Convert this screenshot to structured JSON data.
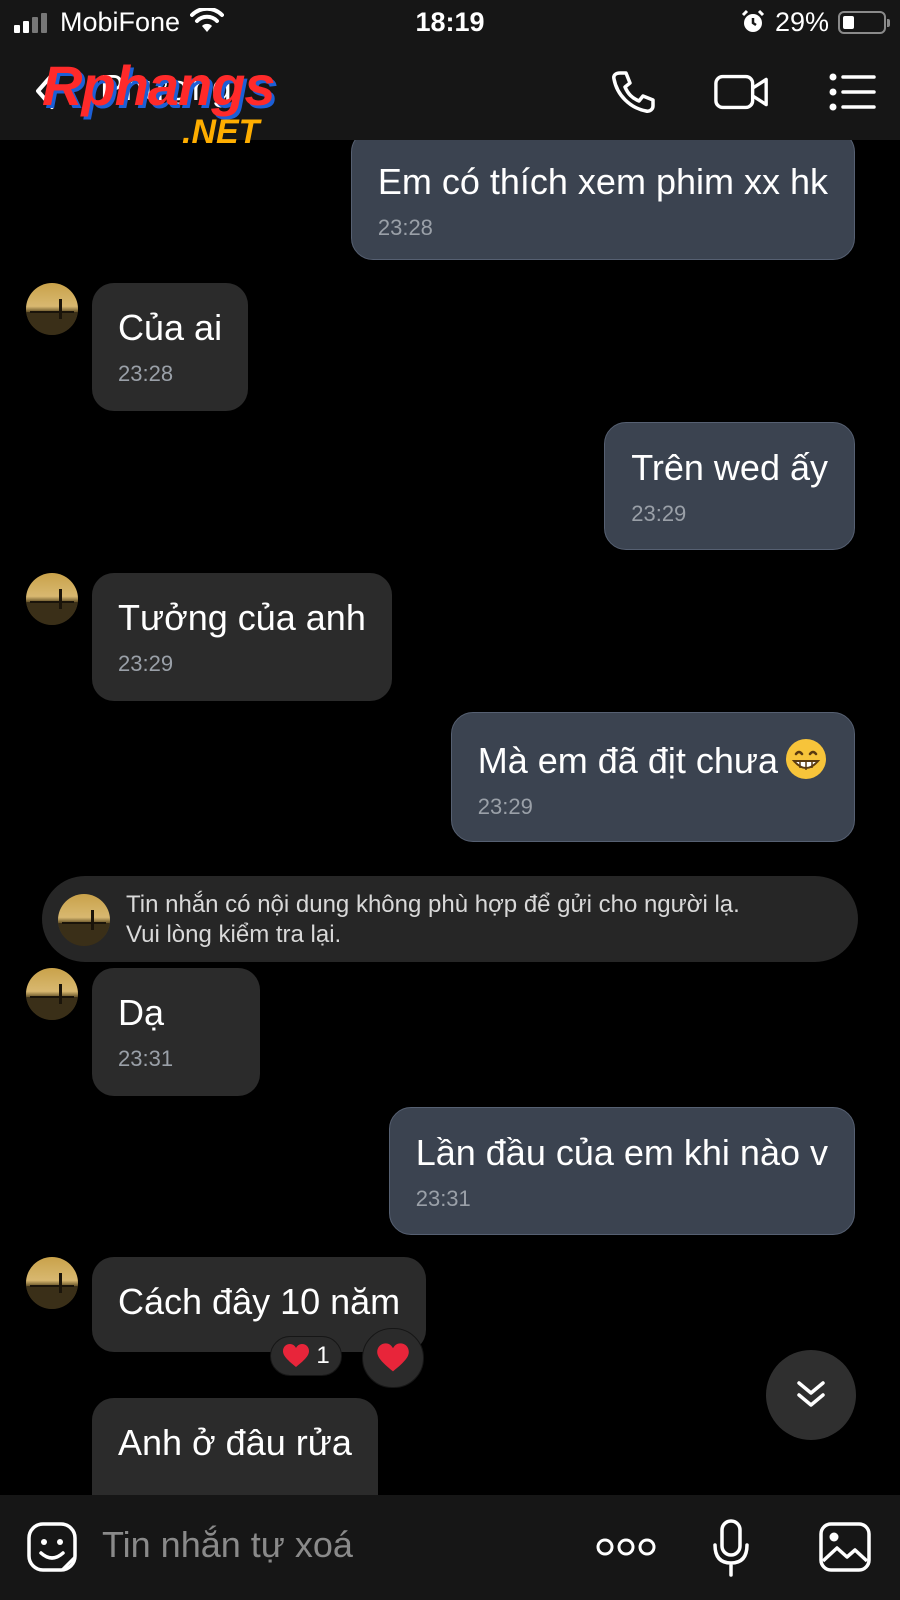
{
  "status_bar": {
    "carrier": "MobiFone",
    "time": "18:19",
    "battery": "29%"
  },
  "header": {
    "contact_name": "Phượng",
    "watermark_text": "Rphangs",
    "watermark_suffix": ".NET",
    "icons": [
      "back-chevron-icon",
      "phone-icon",
      "video-camera-icon",
      "menu-list-icon"
    ]
  },
  "messages": [
    {
      "dir": "out",
      "text": "Em có thích xem phim xx hk",
      "time": "23:28"
    },
    {
      "dir": "in",
      "text": "Của ai",
      "time": "23:28"
    },
    {
      "dir": "out",
      "text": "Trên wed ấy",
      "time": "23:29"
    },
    {
      "dir": "in",
      "text": "Tưởng của anh",
      "time": "23:29"
    },
    {
      "dir": "out",
      "text": "Mà em đã địt chưa",
      "time": "23:29",
      "emoji": "grinning-face-icon"
    },
    {
      "dir": "in",
      "text": "Dạ",
      "time": "23:31"
    },
    {
      "dir": "out",
      "text": "Lần đầu của em khi nào v",
      "time": "23:31"
    },
    {
      "dir": "in",
      "text": "Cách đây 10 năm",
      "time": ""
    },
    {
      "dir": "in",
      "text": "Anh ở đâu rửa",
      "time": ""
    }
  ],
  "notice": {
    "line1": "Tin nhắn có nội dung không phù hợp để gửi cho người lạ.",
    "line2": "Vui lòng kiểm tra lại."
  },
  "reaction": {
    "count": "1",
    "emoji": "heart-icon"
  },
  "composer": {
    "placeholder": "Tin nhắn tự xoá",
    "icons": [
      "sticker-icon",
      "more-dots-icon",
      "microphone-icon",
      "image-icon"
    ]
  },
  "colors": {
    "background": "#000000",
    "bar": "#161616",
    "incoming_bubble": "#2b2b2b",
    "outgoing_bubble": "#3b4350",
    "timestamp": "#9aa0a8"
  }
}
